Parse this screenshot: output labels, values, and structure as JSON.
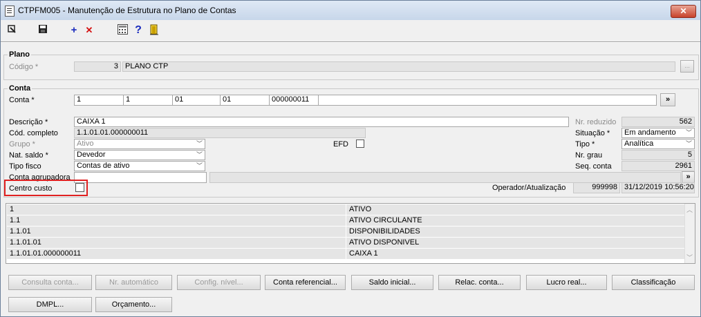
{
  "window": {
    "title": "CTPFM005 - Manutenção de Estrutura no Plano de Contas",
    "close_label": "✕"
  },
  "toolbar": {
    "exit_icon": "exit-icon",
    "save_icon": "save-icon",
    "add_label": "+",
    "delete_label": "✕",
    "help_label": "?"
  },
  "plano": {
    "group_title": "Plano",
    "codigo_label": "Código *",
    "codigo_value": "3",
    "nome_value": "PLANO CTP",
    "lookup_label": "..."
  },
  "conta": {
    "group_title": "Conta",
    "conta_label": "Conta *",
    "segments": [
      "1",
      "1",
      "01",
      "01",
      "000000011"
    ],
    "lookup_label": "»",
    "descricao_label": "Descrição *",
    "descricao_value": "CAIXA 1",
    "cod_completo_label": "Cód. completo",
    "cod_completo_value": "1.1.01.01.000000011",
    "grupo_label": "Grupo *",
    "grupo_value": "Ativo",
    "efd_label": "EFD",
    "nat_saldo_label": "Nat. saldo *",
    "nat_saldo_value": "Devedor",
    "tipo_fisco_label": "Tipo fisco",
    "tipo_fisco_value": "Contas de ativo",
    "conta_agrupadora_label": "Conta agrupadora",
    "conta_agrupadora_lookup": "»",
    "centro_custo_label": "Centro custo",
    "nr_reduzido_label": "Nr. reduzido",
    "nr_reduzido_value": "562",
    "situacao_label": "Situação *",
    "situacao_value": "Em andamento",
    "tipo_label": "Tipo *",
    "tipo_value": "Analítica",
    "nr_grau_label": "Nr. grau",
    "nr_grau_value": "5",
    "seq_conta_label": "Seq. conta",
    "seq_conta_value": "2961",
    "operador_label": "Operador/Atualização",
    "operador_value": "999998",
    "atualizacao_value": "31/12/2019 10:56:20"
  },
  "grid": {
    "rows": [
      {
        "code": "1",
        "name": "ATIVO"
      },
      {
        "code": "1.1",
        "name": "ATIVO CIRCULANTE"
      },
      {
        "code": "1.1.01",
        "name": "DISPONIBILIDADES"
      },
      {
        "code": "1.1.01.01",
        "name": "ATIVO DISPONIVEL"
      },
      {
        "code": "1.1.01.01.000000011",
        "name": "CAIXA 1"
      }
    ]
  },
  "buttons": {
    "consulta_conta": "Consulta conta...",
    "nr_automatico": "Nr. automático",
    "config_nivel": "Config. nível...",
    "conta_referencial": "Conta referencial...",
    "saldo_inicial": "Saldo inicial...",
    "relac_conta": "Relac. conta...",
    "lucro_real": "Lucro real...",
    "classificacao": "Classificação",
    "dmpl": "DMPL...",
    "orcamento": "Orçamento..."
  },
  "colors": {
    "highlight_red": "#e02020",
    "titlebar": "#c7d6ea",
    "readonly_bg": "#e4e4e4"
  }
}
